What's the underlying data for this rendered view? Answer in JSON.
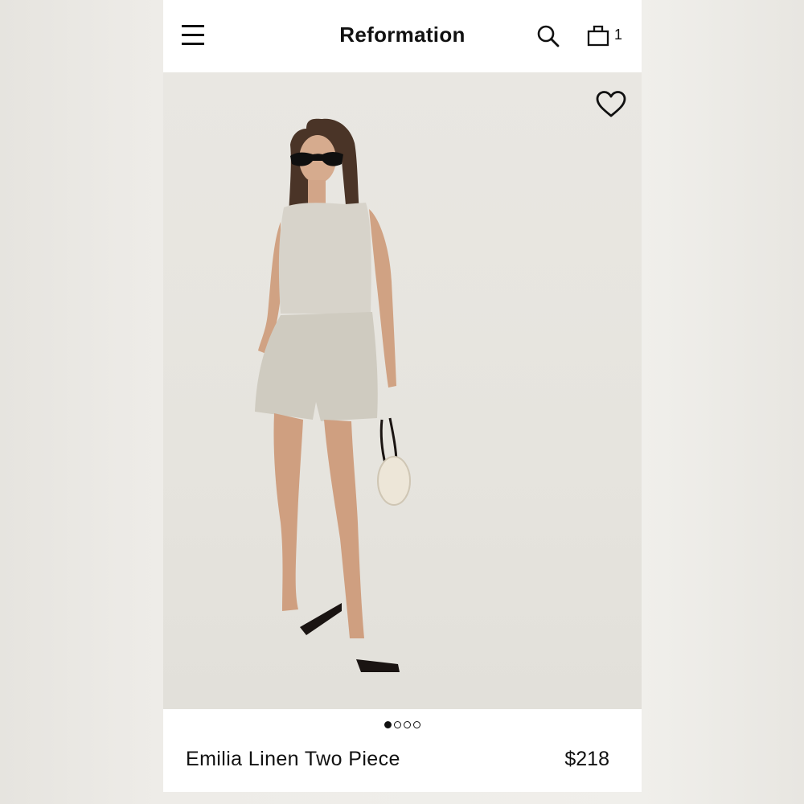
{
  "header": {
    "brand": "Reformation",
    "bag_count": "1",
    "icons": [
      "hamburger-menu-icon",
      "search-icon",
      "shopping-bag-icon"
    ]
  },
  "product": {
    "name": "Emilia Linen Two Piece",
    "price": "$218",
    "favorite_icon": "heart-outline-icon",
    "carousel": {
      "total": 4,
      "active_index": 0
    },
    "image_alt": "Model wearing a linen sleeveless crop top and matching shorts with black sandals and a beaded bag"
  },
  "colors": {
    "background": "#ffffff",
    "text": "#111111",
    "photo_backdrop": "#e7e5e0"
  }
}
